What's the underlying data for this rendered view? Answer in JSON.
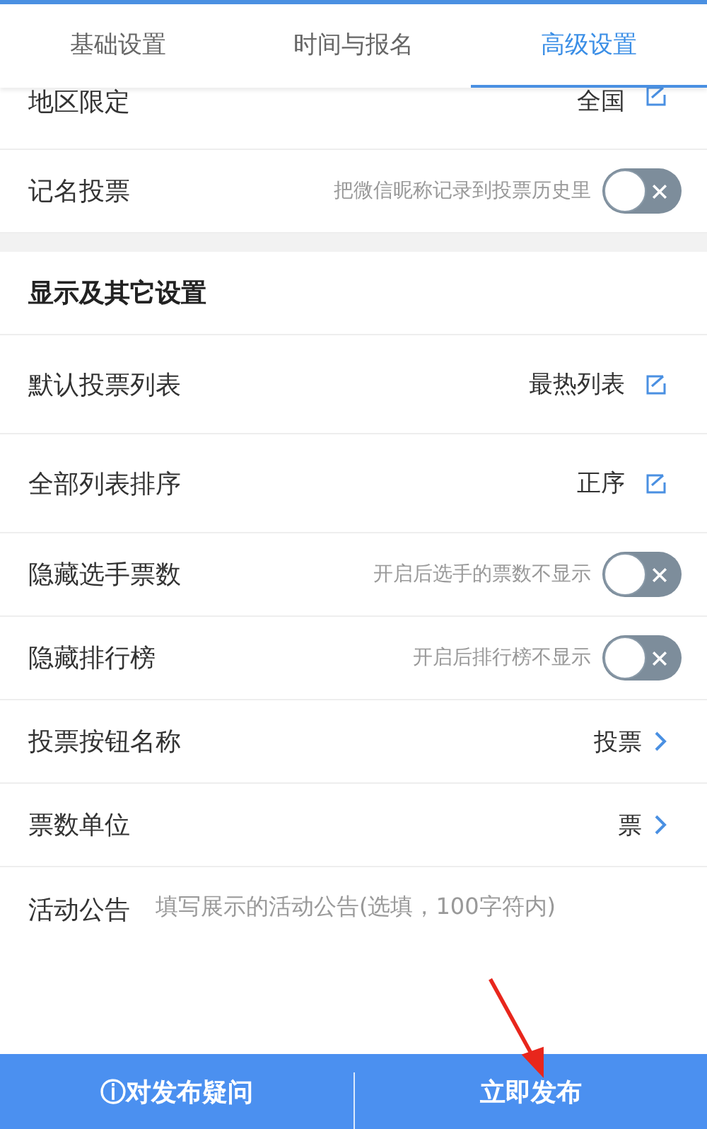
{
  "tabs": [
    {
      "label": "基础设置",
      "selected": false
    },
    {
      "label": "时间与报名",
      "selected": false
    },
    {
      "label": "高级设置",
      "selected": true
    }
  ],
  "top_rows": [
    {
      "kind": "edit",
      "label": "地区限定",
      "value": "全国"
    },
    {
      "kind": "toggle",
      "label": "记名投票",
      "hint": "把微信昵称记录到投票历史里",
      "on": false
    }
  ],
  "section": {
    "title": "显示及其它设置",
    "rows": [
      {
        "kind": "edit",
        "label": "默认投票列表",
        "value": "最热列表"
      },
      {
        "kind": "edit",
        "label": "全部列表排序",
        "value": "正序"
      },
      {
        "kind": "toggle",
        "label": "隐藏选手票数",
        "hint": "开启后选手的票数不显示",
        "on": false
      },
      {
        "kind": "toggle",
        "label": "隐藏排行榜",
        "hint": "开启后排行榜不显示",
        "on": false
      },
      {
        "kind": "link",
        "label": "投票按钮名称",
        "value": "投票"
      },
      {
        "kind": "link",
        "label": "票数单位",
        "value": "票"
      },
      {
        "kind": "input",
        "label": "活动公告",
        "placeholder": "填写展示的活动公告(选填，100字符内)"
      }
    ]
  },
  "bottom_bar": {
    "help_button": "ⓘ对发布疑问",
    "publish_button": "立即发布"
  }
}
